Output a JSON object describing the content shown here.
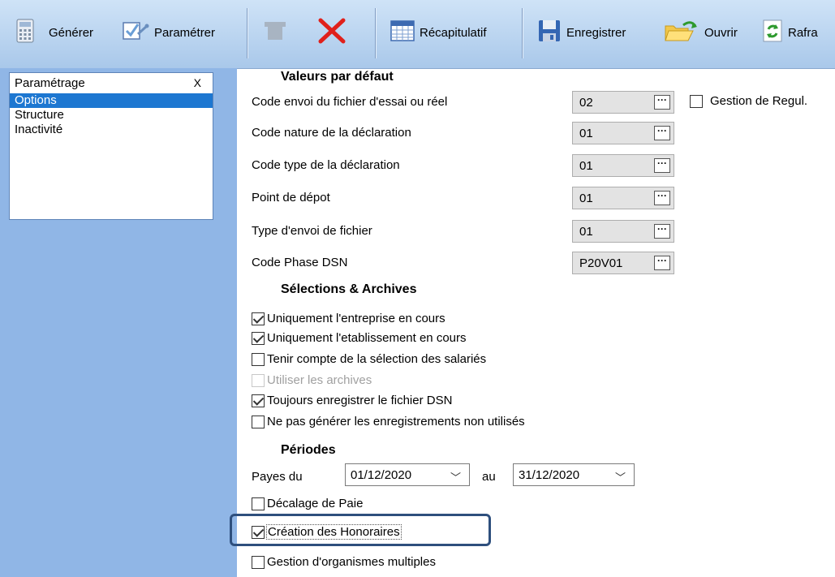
{
  "toolbar": {
    "generer": "Générer",
    "parametrer": "Paramétrer",
    "recap": "Récapitulatif",
    "enregistrer": "Enregistrer",
    "ouvrir": "Ouvrir",
    "rafraichir": "Rafra"
  },
  "left_panel": {
    "title": "Paramétrage",
    "close": "X",
    "items": [
      "Options",
      "Structure",
      "Inactivité"
    ]
  },
  "defaults": {
    "title": "Valeurs par défaut",
    "fields": [
      {
        "label": "Code envoi du fichier d'essai ou réel",
        "value": "02"
      },
      {
        "label": "Code nature de la déclaration",
        "value": "01"
      },
      {
        "label": "Code type de la déclaration",
        "value": "01"
      },
      {
        "label": "Point de dépot",
        "value": "01"
      },
      {
        "label": "Type d'envoi de fichier",
        "value": "01"
      },
      {
        "label": "Code Phase DSN",
        "value": "P20V01"
      }
    ],
    "dots": "···",
    "gestion_regul": "Gestion de Regul."
  },
  "selections": {
    "title": "Sélections & Archives",
    "options": [
      {
        "label": "Uniquement l'entreprise en cours",
        "checked": true,
        "disabled": false
      },
      {
        "label": "Uniquement l'etablissement en cours",
        "checked": true,
        "disabled": false
      },
      {
        "label": "Tenir compte de la sélection des salariés",
        "checked": false,
        "disabled": false
      },
      {
        "label": "Utiliser les archives",
        "checked": false,
        "disabled": true
      },
      {
        "label": "Toujours enregistrer le fichier DSN",
        "checked": true,
        "disabled": false
      },
      {
        "label": "Ne pas générer les enregistrements non utilisés",
        "checked": false,
        "disabled": false
      }
    ]
  },
  "periodes": {
    "title": "Périodes",
    "payes_du": "Payes du",
    "from": "01/12/2020",
    "au": "au",
    "to": "31/12/2020",
    "chevron": "﹀",
    "decalage": "Décalage de Paie",
    "creation": "Création des Honoraires",
    "gestion_org": "Gestion d'organismes multiples"
  },
  "colors": {
    "toolbar_bg": "#b8d3f0",
    "left_bg": "#90b6e6",
    "selection": "#1d77d1",
    "highlight_border": "#2e4f7d",
    "delete_red": "#e0201b"
  }
}
